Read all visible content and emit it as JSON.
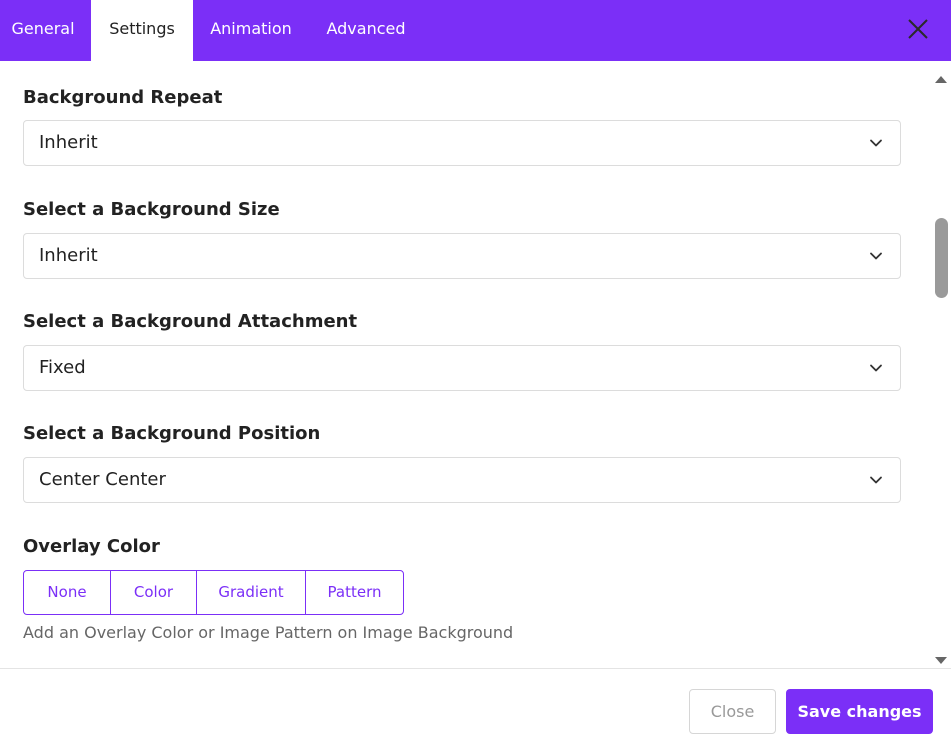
{
  "tabs": [
    {
      "label": "General"
    },
    {
      "label": "Settings",
      "active": true
    },
    {
      "label": "Animation"
    },
    {
      "label": "Advanced"
    }
  ],
  "icons": {
    "close": "close-icon",
    "chevron": "chevron-down-icon",
    "scroll_up": "scroll-up-arrow-icon",
    "scroll_down": "scroll-down-arrow-icon"
  },
  "fields": {
    "background_repeat": {
      "label": "Background Repeat",
      "value": "Inherit"
    },
    "background_size": {
      "label": "Select a Background Size",
      "value": "Inherit"
    },
    "background_attachment": {
      "label": "Select a Background Attachment",
      "value": "Fixed"
    },
    "background_position": {
      "label": "Select a Background Position",
      "value": "Center Center"
    }
  },
  "overlay": {
    "label": "Overlay Color",
    "options": [
      "None",
      "Color",
      "Gradient",
      "Pattern"
    ],
    "help": "Add an Overlay Color or Image Pattern on Image Background"
  },
  "footer": {
    "close_label": "Close",
    "save_label": "Save changes"
  },
  "colors": {
    "accent": "#7b2ff7",
    "border": "#dcdcdc",
    "muted_text": "#666666"
  }
}
